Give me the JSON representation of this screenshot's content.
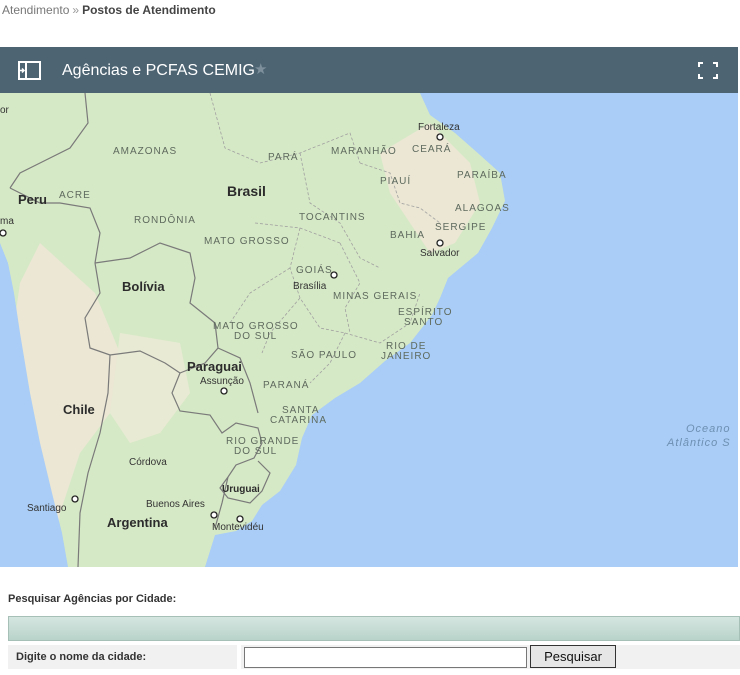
{
  "breadcrumb": {
    "parent": "Atendimento",
    "separator": "»",
    "current": "Postos de Atendimento"
  },
  "panel": {
    "title": "Agências e PCFAS CEMIG",
    "star_glyph": "★",
    "header_color": "#4d6473"
  },
  "map": {
    "colors": {
      "water": "#a9cdf6",
      "land": "#d4e8c4",
      "land_dry": "#ece8d6",
      "border": "#6b6b6b"
    },
    "labels": {
      "amazonas": "AMAZONAS",
      "para": "PARÁ",
      "maranhao": "MARANHÃO",
      "ceara": "CEARÁ",
      "piaui": "PIAUÍ",
      "paraiba": "PARAÍBA",
      "acre": "ACRE",
      "rondonia": "RONDÔNIA",
      "tocantins": "TOCANTINS",
      "alagoas": "ALAGOAS",
      "sergipe": "SERGIPE",
      "bahia": "BAHIA",
      "mato_grosso": "MATO GROSSO",
      "goias": "GOIÁS",
      "minas_gerais": "MINAS GERAIS",
      "espirito_santo_1": "ESPÍRITO",
      "espirito_santo_2": "SANTO",
      "mato_grosso_sul_1": "MATO GROSSO",
      "mato_grosso_sul_2": "DO SUL",
      "sao_paulo": "SÃO PAULO",
      "rio_1": "RIO DE",
      "rio_2": "JANEIRO",
      "parana": "PARANÁ",
      "santa_catarina_1": "SANTA",
      "santa_catarina_2": "CATARINA",
      "rio_grande_1": "RIO GRANDE",
      "rio_grande_2": "DO SUL"
    },
    "countries": {
      "brasil": "Brasil",
      "peru": "Peru",
      "bolivia": "Bolívia",
      "paraguai": "Paraguai",
      "chile": "Chile",
      "argentina": "Argentina",
      "uruguai": "Uruguai"
    },
    "cities": {
      "fortaleza": "Fortaleza",
      "salvador": "Salvador",
      "brasilia": "Brasília",
      "assuncao": "Assunção",
      "cordova": "Córdova",
      "buenos_aires": "Buenos Aires",
      "santiago": "Santiago",
      "montevideu": "Montevidéu",
      "lima_partial": "ma",
      "top_partial": "or"
    },
    "ocean": {
      "line1": "Oceano",
      "line2": "Atlântico S"
    }
  },
  "search": {
    "title": "Pesquisar Agências por Cidade:",
    "label": "Digite o nome da cidade:",
    "input_value": "",
    "button_label": "Pesquisar"
  }
}
